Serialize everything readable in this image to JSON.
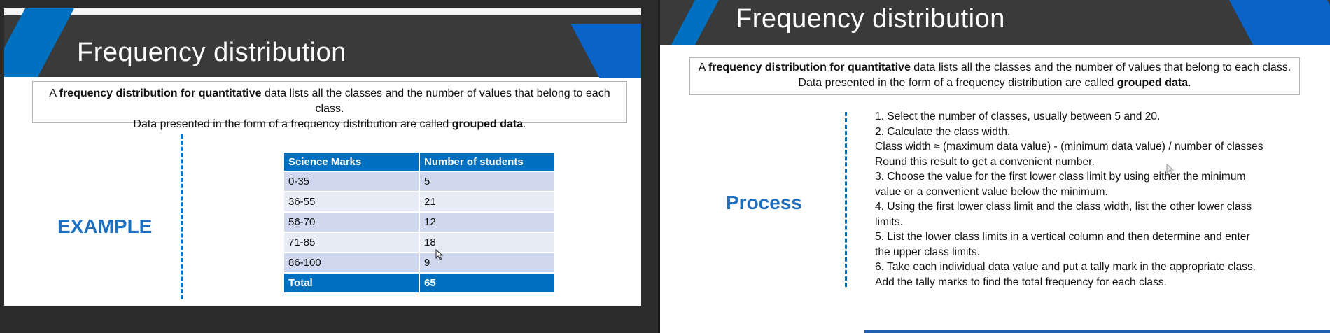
{
  "left_slide": {
    "title": "Frequency distribution",
    "definition": {
      "line1_prefix": "A ",
      "line1_bold": "frequency distribution for quantitative",
      "line1_suffix": " data lists all the classes and the number of values that belong to each class.",
      "line2_prefix": "Data presented in the form of a frequency distribution are called ",
      "line2_bold": "grouped data",
      "line2_suffix": "."
    },
    "section_label": "EXAMPLE",
    "table": {
      "headers": [
        "Science Marks",
        "Number of students"
      ],
      "rows": [
        [
          "0-35",
          "5"
        ],
        [
          "36-55",
          "21"
        ],
        [
          "56-70",
          "12"
        ],
        [
          "71-85",
          "18"
        ],
        [
          "86-100",
          "9"
        ]
      ],
      "total": [
        "Total",
        "65"
      ]
    }
  },
  "right_slide": {
    "title": "Frequency distribution",
    "definition": {
      "line1_prefix": "A ",
      "line1_bold": "frequency distribution for quantitative",
      "line1_suffix": " data lists all the classes and the number of values that belong to each class.",
      "line2_prefix": "Data presented in the form of a frequency distribution are called ",
      "line2_bold": "grouped data",
      "line2_suffix": "."
    },
    "section_label": "Process",
    "steps": [
      "1. Select the number of classes, usually between 5 and 20.",
      "2. Calculate the class width.",
      "Class width ≈ (maximum data value) - (minimum data value) / number of classes",
      "Round this result to get a convenient number.",
      "3. Choose the value for the first lower class limit by using either the minimum",
      "value or a convenient value below the minimum.",
      "4. Using the first lower class limit and the class width, list the other lower class",
      "limits.",
      "5. List the lower class limits in a vertical column and then determine and enter",
      "the upper class limits.",
      "6. Take each individual data value and put a tally mark in the appropriate class.",
      "Add the tally marks to find the total frequency for each class."
    ]
  },
  "colors": {
    "accent_blue": "#0070c0",
    "label_blue": "#1f6fbf",
    "band_dark": "#3a3a3a"
  }
}
